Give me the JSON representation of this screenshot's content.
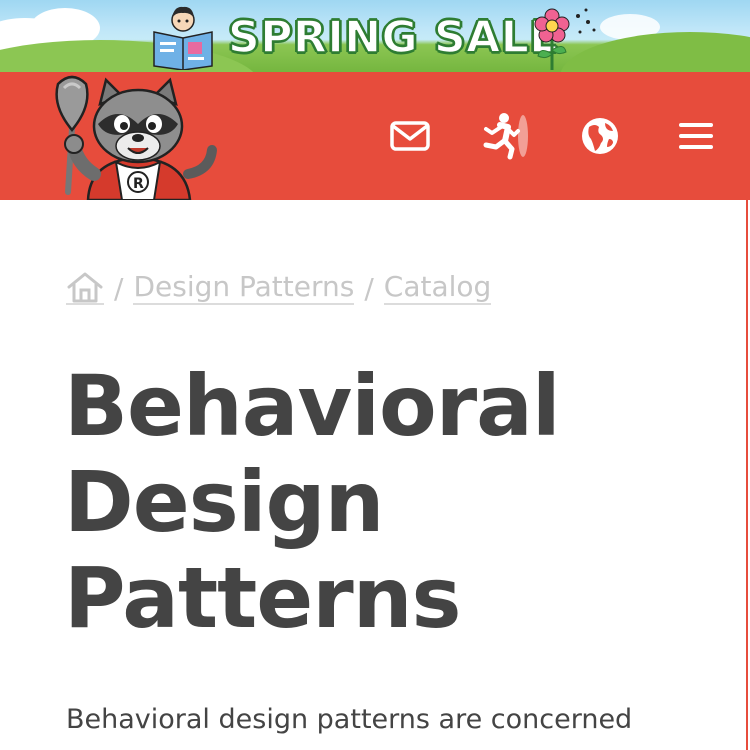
{
  "promo": {
    "text": "SPRING SALE"
  },
  "header": {
    "icons": {
      "mascot": "raccoon-mascot-logo",
      "mail": "envelope-icon",
      "run": "running-person-icon",
      "globe": "globe-icon",
      "menu": "hamburger-menu-icon"
    },
    "colors": {
      "background": "#e74c3c",
      "icon": "#ffffff"
    }
  },
  "breadcrumb": {
    "home_icon": "home-icon",
    "separator": "/",
    "items": [
      "Design Patterns",
      "Catalog"
    ]
  },
  "page": {
    "title": "Behavioral Design Patterns",
    "intro": "Behavioral design patterns are concerned"
  },
  "colors": {
    "accent": "#e74c3c",
    "text": "#444444",
    "muted": "#c7c7c7"
  }
}
